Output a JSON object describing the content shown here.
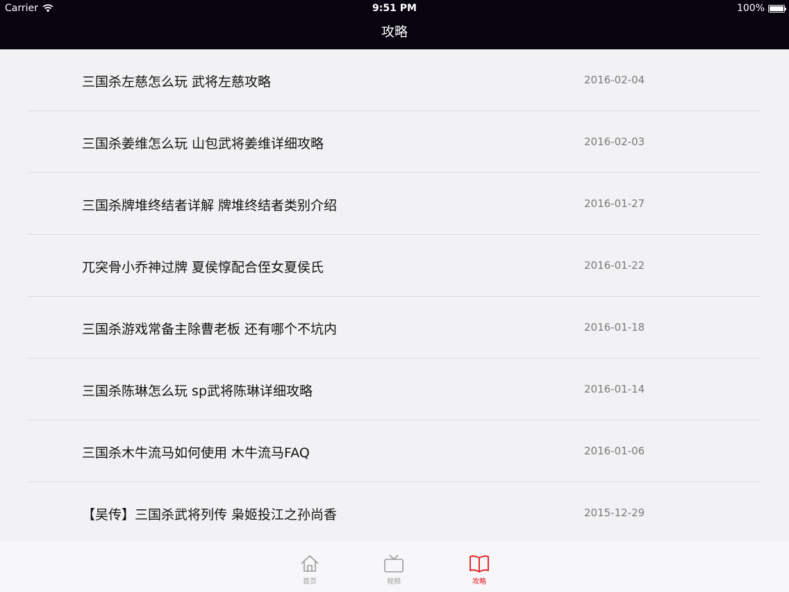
{
  "status_bar": {
    "carrier": "Carrier",
    "time": "9:51 PM",
    "battery": "100%"
  },
  "nav": {
    "title": "攻略"
  },
  "articles": [
    {
      "title": "三国杀左慈怎么玩 武将左慈攻略",
      "date": "2016-02-04"
    },
    {
      "title": "三国杀姜维怎么玩 山包武将姜维详细攻略",
      "date": "2016-02-03"
    },
    {
      "title": "三国杀牌堆终结者详解 牌堆终结者类别介绍",
      "date": "2016-01-27"
    },
    {
      "title": "兀突骨小乔神过牌 夏侯惇配合侄女夏侯氏",
      "date": "2016-01-22"
    },
    {
      "title": "三国杀游戏常备主除曹老板 还有哪个不坑内",
      "date": "2016-01-18"
    },
    {
      "title": "三国杀陈琳怎么玩 sp武将陈琳详细攻略",
      "date": "2016-01-14"
    },
    {
      "title": "三国杀木牛流马如何使用 木牛流马FAQ",
      "date": "2016-01-06"
    },
    {
      "title": "【吴传】三国杀武将列传 枭姬投江之孙尚香",
      "date": "2015-12-29"
    }
  ],
  "tab_bar": {
    "tabs": [
      {
        "label": "首页",
        "icon": "home-icon"
      },
      {
        "label": "视频",
        "icon": "tv-icon"
      },
      {
        "label": "攻略",
        "icon": "book-icon"
      }
    ],
    "active_index": 2,
    "active_color": "#e0171b",
    "inactive_color": "#9a9a9a"
  }
}
